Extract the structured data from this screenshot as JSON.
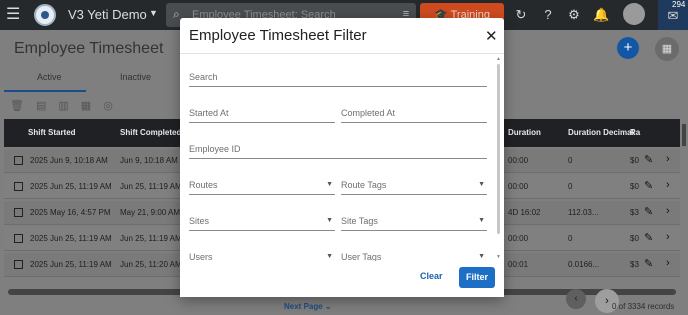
{
  "appbar": {
    "app_title": "V3 Yeti Demo",
    "search_placeholder": "Employee Timesheet: Search",
    "training_label": "Training",
    "notification_count": "294"
  },
  "page": {
    "title": "Employee Timesheet",
    "tabs": [
      "Active",
      "Inactive"
    ],
    "columns": [
      "Shift Started",
      "Shift Completed",
      "Duration",
      "Duration Decimal",
      "Ra"
    ],
    "rows": [
      {
        "started": "2025 Jun 9, 10:18 AM",
        "completed": "Jun 9, 10:18 AM",
        "duration": "00:00",
        "decimal": "0",
        "rate": "$0"
      },
      {
        "started": "2025 Jun 25, 11:19 AM",
        "completed": "Jun 25, 11:19 AM",
        "duration": "00:00",
        "decimal": "0",
        "rate": "$0"
      },
      {
        "started": "2025 May 16, 4:57 PM",
        "completed": "May 21, 9:00 AM",
        "duration": "4D 16:02",
        "decimal": "112.03...",
        "rate": "$3"
      },
      {
        "started": "2025 Jun 25, 11:19 AM",
        "completed": "Jun 25, 11:19 AM",
        "duration": "00:00",
        "decimal": "0",
        "rate": "$0"
      },
      {
        "started": "2025 Jun 25, 11:19 AM",
        "completed": "Jun 25, 11:20 AM",
        "duration": "00:01",
        "decimal": "0.0166...",
        "rate": "$3"
      }
    ],
    "next_page_label": "Next Page",
    "records_text": "0 of 3334 records"
  },
  "dialog": {
    "title": "Employee Timesheet Filter",
    "fields": {
      "search": "Search",
      "started_at": "Started At",
      "completed_at": "Completed At",
      "employee_id": "Employee ID",
      "routes": "Routes",
      "route_tags": "Route Tags",
      "sites": "Sites",
      "site_tags": "Site Tags",
      "users": "Users",
      "user_tags": "User Tags"
    },
    "clear_label": "Clear",
    "filter_label": "Filter"
  },
  "colors": {
    "primary": "#1d6fc6",
    "training": "#cf4b1f",
    "appbar": "#26292c"
  }
}
